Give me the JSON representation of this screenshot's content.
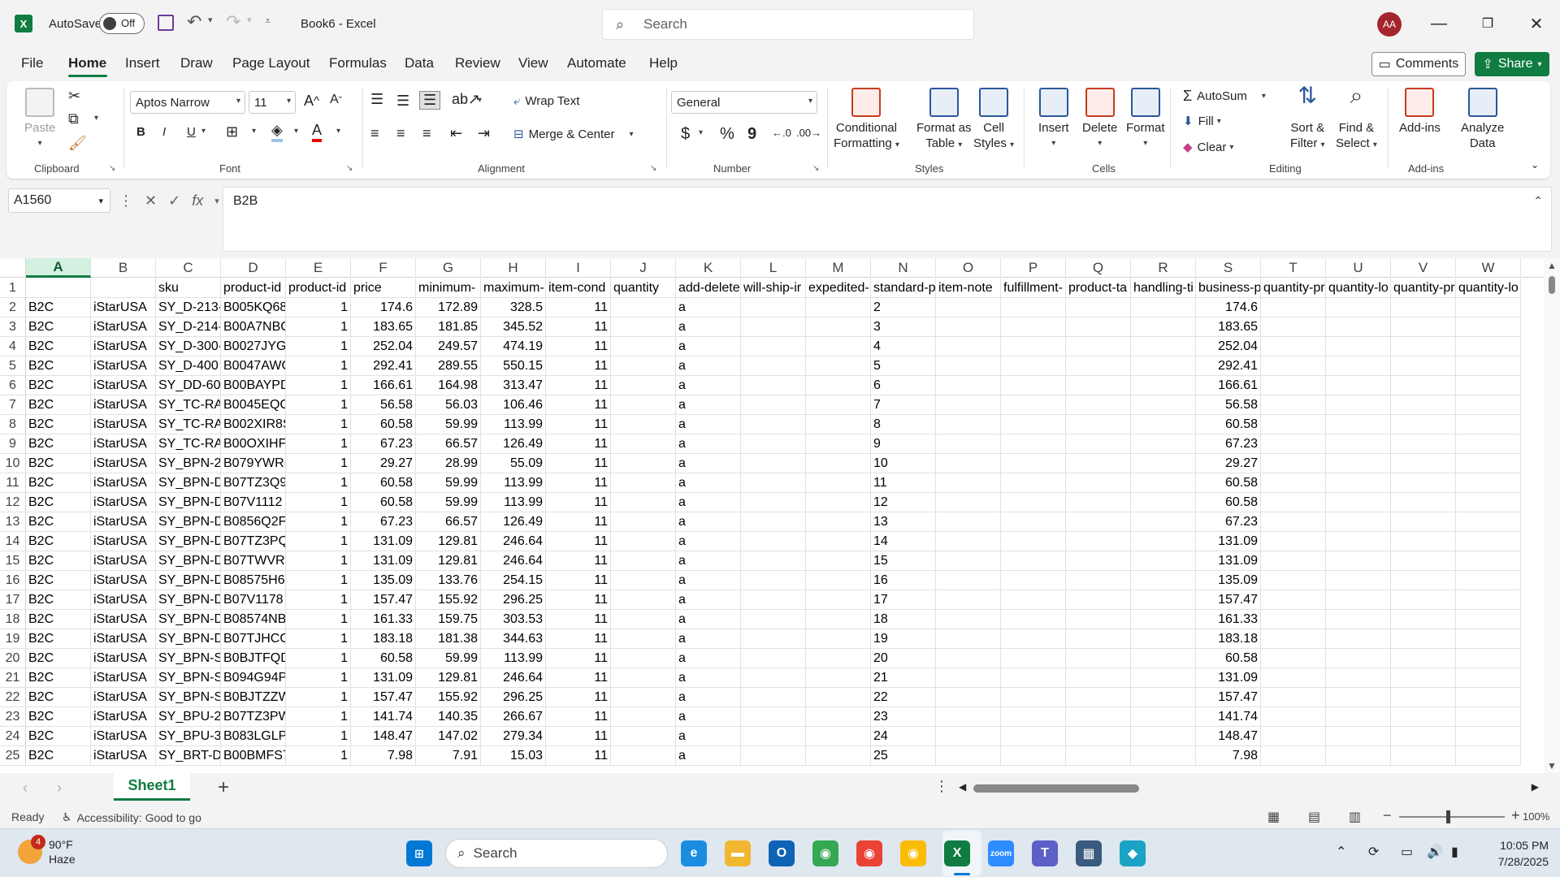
{
  "titlebar": {
    "app_logo": "X",
    "autosave_label": "AutoSave",
    "autosave_state": "Off",
    "doc_title": "Book6 - Excel",
    "search_placeholder": "Search",
    "avatar_initials": "AA",
    "icons": [
      "excel-logo",
      "save-icon",
      "undo-icon",
      "redo-icon",
      "customize-qat-icon",
      "search-icon",
      "minimize-icon",
      "maximize-icon",
      "close-icon"
    ]
  },
  "tabs": [
    {
      "label": "File"
    },
    {
      "label": "Home"
    },
    {
      "label": "Insert"
    },
    {
      "label": "Draw"
    },
    {
      "label": "Page Layout"
    },
    {
      "label": "Formulas"
    },
    {
      "label": "Data"
    },
    {
      "label": "Review"
    },
    {
      "label": "View"
    },
    {
      "label": "Automate"
    },
    {
      "label": "Help"
    }
  ],
  "active_tab": "Home",
  "comments_label": "Comments",
  "share_label": "Share",
  "ribbon": {
    "clipboard": {
      "label": "Clipboard",
      "paste": "Paste"
    },
    "font": {
      "label": "Font",
      "name": "Aptos Narrow",
      "size": "11",
      "bold": "B",
      "italic": "I",
      "underline": "U"
    },
    "alignment": {
      "label": "Alignment",
      "wrap": "Wrap Text",
      "merge": "Merge & Center"
    },
    "number": {
      "label": "Number",
      "format": "General",
      "currency": "$",
      "percent": "%",
      "comma": "9"
    },
    "styles": {
      "label": "Styles",
      "conditional": "Conditional",
      "conditional2": "Formatting",
      "format_table": "Format as",
      "format_table2": "Table",
      "cell_styles": "Cell",
      "cell_styles2": "Styles"
    },
    "cells": {
      "label": "Cells",
      "insert": "Insert",
      "delete": "Delete",
      "format": "Format"
    },
    "editing": {
      "label": "Editing",
      "autosum": "AutoSum",
      "fill": "Fill",
      "clear": "Clear",
      "sort": "Sort &",
      "sort2": "Filter",
      "find": "Find &",
      "find2": "Select"
    },
    "addins": {
      "label": "Add-ins",
      "addins_btn": "Add-ins",
      "analyze": "Analyze",
      "analyze2": "Data"
    }
  },
  "formula_bar": {
    "name_box": "A1560",
    "fx": "fx",
    "value": "B2B"
  },
  "grid": {
    "selected_column": "A",
    "columns": [
      "A",
      "B",
      "C",
      "D",
      "E",
      "F",
      "G",
      "H",
      "I",
      "J",
      "K",
      "L",
      "M",
      "N",
      "O",
      "P",
      "Q",
      "R",
      "S",
      "T",
      "U",
      "V",
      "W"
    ],
    "header_row": [
      "",
      "",
      "sku",
      "product-id",
      "product-id",
      "price",
      "minimum-",
      "maximum-",
      "item-cond",
      "quantity",
      "add-delete",
      "will-ship-ir",
      "expedited-",
      "standard-p",
      "item-note",
      "fulfillment-",
      "product-ta",
      "handling-ti",
      "business-p",
      "quantity-pr",
      "quantity-lo",
      "quantity-pr",
      "quantity-lo"
    ],
    "rows": [
      {
        "n": "2",
        "a": "B2C",
        "b": "iStarUSA",
        "c": "SY_D-213-",
        "d": "B005KQ68",
        "e": "1",
        "f": "174.6",
        "g": "172.89",
        "h": "328.5",
        "i": "11",
        "k": "a",
        "s": "174.6"
      },
      {
        "n": "3",
        "a": "B2C",
        "b": "iStarUSA",
        "c": "SY_D-214-",
        "d": "B00A7NBC",
        "e": "1",
        "f": "183.65",
        "g": "181.85",
        "h": "345.52",
        "i": "11",
        "k": "a",
        "s": "183.65"
      },
      {
        "n": "4",
        "a": "B2C",
        "b": "iStarUSA",
        "c": "SY_D-300-",
        "d": "B0027JYGI",
        "e": "1",
        "f": "252.04",
        "g": "249.57",
        "h": "474.19",
        "i": "11",
        "k": "a",
        "s": "252.04"
      },
      {
        "n": "5",
        "a": "B2C",
        "b": "iStarUSA",
        "c": "SY_D-400",
        "d": "B0047AWC",
        "e": "1",
        "f": "292.41",
        "g": "289.55",
        "h": "550.15",
        "i": "11",
        "k": "a",
        "s": "292.41"
      },
      {
        "n": "6",
        "a": "B2C",
        "b": "iStarUSA",
        "c": "SY_DD-603",
        "d": "B00BAYPD",
        "e": "1",
        "f": "166.61",
        "g": "164.98",
        "h": "313.47",
        "i": "11",
        "k": "a",
        "s": "166.61"
      },
      {
        "n": "7",
        "a": "B2C",
        "b": "iStarUSA",
        "c": "SY_TC-RAI",
        "d": "B0045EQC",
        "e": "1",
        "f": "56.58",
        "g": "56.03",
        "h": "106.46",
        "i": "11",
        "k": "a",
        "s": "56.58"
      },
      {
        "n": "8",
        "a": "B2C",
        "b": "iStarUSA",
        "c": "SY_TC-RAI",
        "d": "B002XIR8S",
        "e": "1",
        "f": "60.58",
        "g": "59.99",
        "h": "113.99",
        "i": "11",
        "k": "a",
        "s": "60.58"
      },
      {
        "n": "9",
        "a": "B2C",
        "b": "iStarUSA",
        "c": "SY_TC-RAI",
        "d": "B00OXIHF.",
        "e": "1",
        "f": "67.23",
        "g": "66.57",
        "h": "126.49",
        "i": "11",
        "k": "a",
        "s": "67.23"
      },
      {
        "n": "10",
        "a": "B2C",
        "b": "iStarUSA",
        "c": "SY_BPN-2!",
        "d": "B079YWR(",
        "e": "1",
        "f": "29.27",
        "g": "28.99",
        "h": "55.09",
        "i": "11",
        "k": "a",
        "s": "29.27"
      },
      {
        "n": "11",
        "a": "B2C",
        "b": "iStarUSA",
        "c": "SY_BPN-DI",
        "d": "B07TZ3Q9",
        "e": "1",
        "f": "60.58",
        "g": "59.99",
        "h": "113.99",
        "i": "11",
        "k": "a",
        "s": "60.58"
      },
      {
        "n": "12",
        "a": "B2C",
        "b": "iStarUSA",
        "c": "SY_BPN-DI",
        "d": "B07V1112",
        "e": "1",
        "f": "60.58",
        "g": "59.99",
        "h": "113.99",
        "i": "11",
        "k": "a",
        "s": "60.58"
      },
      {
        "n": "13",
        "a": "B2C",
        "b": "iStarUSA",
        "c": "SY_BPN-DI",
        "d": "B0856Q2F",
        "e": "1",
        "f": "67.23",
        "g": "66.57",
        "h": "126.49",
        "i": "11",
        "k": "a",
        "s": "67.23"
      },
      {
        "n": "14",
        "a": "B2C",
        "b": "iStarUSA",
        "c": "SY_BPN-DI",
        "d": "B07TZ3PQ",
        "e": "1",
        "f": "131.09",
        "g": "129.81",
        "h": "246.64",
        "i": "11",
        "k": "a",
        "s": "131.09"
      },
      {
        "n": "15",
        "a": "B2C",
        "b": "iStarUSA",
        "c": "SY_BPN-DI",
        "d": "B07TWVRY",
        "e": "1",
        "f": "131.09",
        "g": "129.81",
        "h": "246.64",
        "i": "11",
        "k": "a",
        "s": "131.09"
      },
      {
        "n": "16",
        "a": "B2C",
        "b": "iStarUSA",
        "c": "SY_BPN-DI",
        "d": "B08575H6",
        "e": "1",
        "f": "135.09",
        "g": "133.76",
        "h": "254.15",
        "i": "11",
        "k": "a",
        "s": "135.09"
      },
      {
        "n": "17",
        "a": "B2C",
        "b": "iStarUSA",
        "c": "SY_BPN-DI",
        "d": "B07V1178",
        "e": "1",
        "f": "157.47",
        "g": "155.92",
        "h": "296.25",
        "i": "11",
        "k": "a",
        "s": "157.47"
      },
      {
        "n": "18",
        "a": "B2C",
        "b": "iStarUSA",
        "c": "SY_BPN-DI",
        "d": "B08574NB",
        "e": "1",
        "f": "161.33",
        "g": "159.75",
        "h": "303.53",
        "i": "11",
        "k": "a",
        "s": "161.33"
      },
      {
        "n": "19",
        "a": "B2C",
        "b": "iStarUSA",
        "c": "SY_BPN-DI",
        "d": "B07TJHCG",
        "e": "1",
        "f": "183.18",
        "g": "181.38",
        "h": "344.63",
        "i": "11",
        "k": "a",
        "s": "183.18"
      },
      {
        "n": "20",
        "a": "B2C",
        "b": "iStarUSA",
        "c": "SY_BPN-SI",
        "d": "B0BJTFQD",
        "e": "1",
        "f": "60.58",
        "g": "59.99",
        "h": "113.99",
        "i": "11",
        "k": "a",
        "s": "60.58"
      },
      {
        "n": "21",
        "a": "B2C",
        "b": "iStarUSA",
        "c": "SY_BPN-SI",
        "d": "B094G94P",
        "e": "1",
        "f": "131.09",
        "g": "129.81",
        "h": "246.64",
        "i": "11",
        "k": "a",
        "s": "131.09"
      },
      {
        "n": "22",
        "a": "B2C",
        "b": "iStarUSA",
        "c": "SY_BPN-SI",
        "d": "B0BJTZZW",
        "e": "1",
        "f": "157.47",
        "g": "155.92",
        "h": "296.25",
        "i": "11",
        "k": "a",
        "s": "157.47"
      },
      {
        "n": "23",
        "a": "B2C",
        "b": "iStarUSA",
        "c": "SY_BPU-23",
        "d": "B07TZ3PW",
        "e": "1",
        "f": "141.74",
        "g": "140.35",
        "h": "266.67",
        "i": "11",
        "k": "a",
        "s": "141.74"
      },
      {
        "n": "24",
        "a": "B2C",
        "b": "iStarUSA",
        "c": "SY_BPU-34",
        "d": "B083LGLP",
        "e": "1",
        "f": "148.47",
        "g": "147.02",
        "h": "279.34",
        "i": "11",
        "k": "a",
        "s": "148.47"
      },
      {
        "n": "25",
        "a": "B2C",
        "b": "iStarUSA",
        "c": "SY_BRT-D3",
        "d": "B00BMFS7",
        "e": "1",
        "f": "7.98",
        "g": "7.91",
        "h": "15.03",
        "i": "11",
        "k": "a",
        "s": "7.98"
      }
    ]
  },
  "sheet_tab": "Sheet1",
  "status": {
    "ready": "Ready",
    "accessibility": "Accessibility: Good to go",
    "zoom": "100%"
  },
  "taskbar": {
    "temp": "90°F",
    "weather": "Haze",
    "weather_badge": "4",
    "search": "Search",
    "time": "10:05 PM",
    "date": "7/28/2025",
    "apps": [
      {
        "name": "edge-icon",
        "color": "#1b8de0",
        "glyph": "e"
      },
      {
        "name": "file-explorer-icon",
        "color": "#f2b731",
        "glyph": "▬"
      },
      {
        "name": "outlook-icon",
        "color": "#0f63b6",
        "glyph": "O"
      },
      {
        "name": "chrome-icon",
        "color": "#34a853",
        "glyph": "◉"
      },
      {
        "name": "chrome-profile-2-icon",
        "color": "#ea4335",
        "glyph": "◉"
      },
      {
        "name": "chrome-profile-3-icon",
        "color": "#fbbc05",
        "glyph": "◉"
      },
      {
        "name": "excel-taskbar-icon",
        "color": "#107c41",
        "glyph": "X"
      },
      {
        "name": "zoom-icon",
        "color": "#2d8cff",
        "glyph": "zoom"
      },
      {
        "name": "teams-icon",
        "color": "#5b5fc7",
        "glyph": "T"
      },
      {
        "name": "calculator-icon",
        "color": "#3a5a80",
        "glyph": "▦"
      },
      {
        "name": "app-diamond-icon",
        "color": "#1aa3c4",
        "glyph": "◆"
      }
    ]
  },
  "colors": {
    "accent": "#107c41",
    "ribbon_bg": "#ffffff",
    "chrome_bg": "#f3f3f3"
  }
}
